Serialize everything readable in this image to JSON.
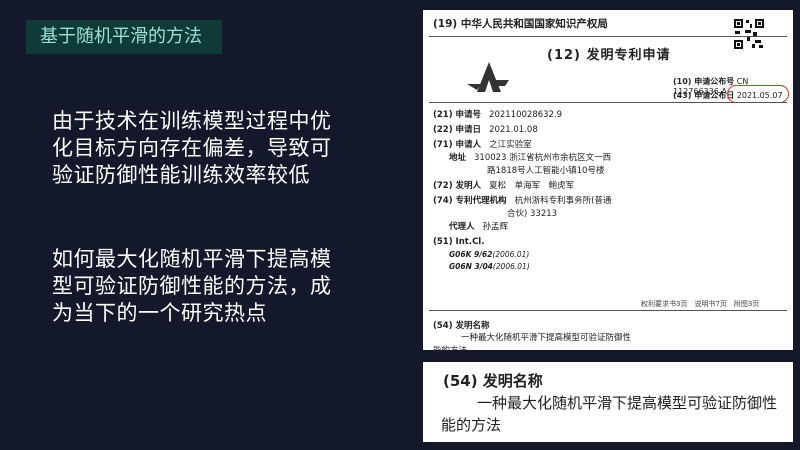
{
  "slide": {
    "title": "基于随机平滑的方法",
    "paragraph1": "由于技术在训练模型过程中优化目标方向存在偏差，导致可验证防御性能训练效率较低",
    "paragraph2": "如何最大化随机平滑下提高模型可验证防御性能的方法，成为当下的一个研究热点"
  },
  "patent": {
    "office": "(19) 中华人民共和国国家知识产权局",
    "doc_type": "(12) 发明专利申请",
    "pub_no_label": "(10) 申请公布号",
    "pub_no": "CN 112766336 A",
    "pub_date_label": "(43) 申请公布日",
    "pub_date": "2021.05.07",
    "app_no_label": "(21) 申请号",
    "app_no": "202110028632.9",
    "app_date_label": "(22) 申请日",
    "app_date": "2021.01.08",
    "applicant_label": "(71) 申请人",
    "applicant": "之江实验室",
    "address_label": "地址",
    "address_line1": "310023 浙江省杭州市余杭区文一西",
    "address_line2": "路1818号人工智能小镇10号楼",
    "inventor_label": "(72) 发明人",
    "inventors": "夏松　单海军　鲍虎军",
    "agency_label": "(74) 专利代理机构",
    "agency_line1": "杭州浙科专利事务所(普通",
    "agency_line2": "合伙) 33213",
    "agent_label": "代理人",
    "agent": "孙孟辉",
    "intcl_label": "(51) Int.Cl.",
    "ipc1_code": "G06K 9/62",
    "ipc1_date": "(2006.01)",
    "ipc2_code": "G06N 3/04",
    "ipc2_date": "(2006.01)",
    "page_info": "权利要求书3页　说明书7页　附图3页",
    "invention_label": "(54) 发明名称",
    "invention_name": "一种最大化随机平滑下提高模型可验证防御性能的方法"
  },
  "zoom": {
    "label": "(54) 发明名称",
    "text": "一种最大化随机平滑下提高模型可验证防御性能的方法"
  },
  "colors": {
    "background": "#14182b",
    "title_bg": "#0e3a38",
    "title_text": "#9ee1d3",
    "highlight_circle": "#d9382b"
  }
}
